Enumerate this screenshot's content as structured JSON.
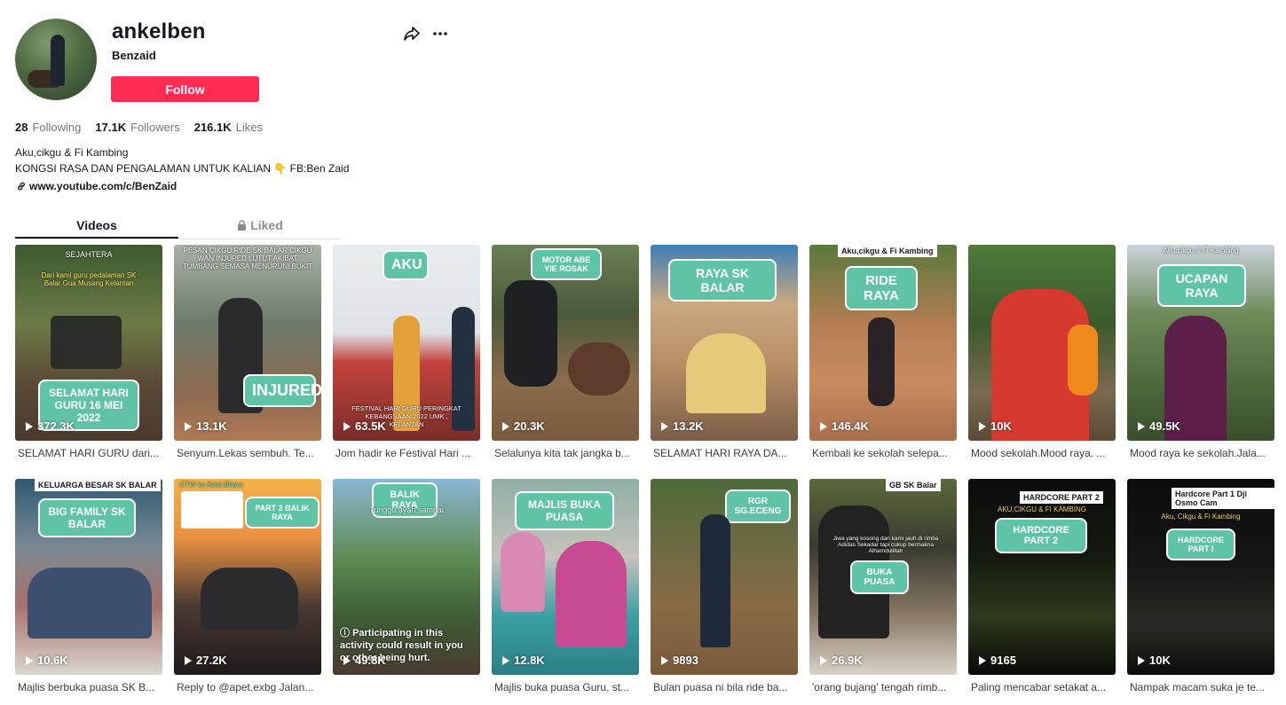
{
  "profile": {
    "username": "ankelben",
    "nickname": "Benzaid",
    "follow_label": "Follow",
    "stats": [
      {
        "value": "28",
        "label": "Following"
      },
      {
        "value": "17.1K",
        "label": "Followers"
      },
      {
        "value": "216.1K",
        "label": "Likes"
      }
    ],
    "bio_line1": "Aku,cikgu & Fi Kambing",
    "bio_line2": "KONGSI RASA DAN PENGALAMAN UNTUK KALIAN 👇 FB:Ben Zaid",
    "link": "www.youtube.com/c/BenZaid"
  },
  "tabs": {
    "videos": "Videos",
    "liked": "Liked"
  },
  "videos": [
    {
      "views": "372.3K",
      "caption": "SELAMAT HARI GURU dari...",
      "bubble": "SELAMAT HARI GURU 16 MEI 2022",
      "overlay": "SEJAHTERA",
      "sub": "Dari kami guru pedalaman SK Balar Gua Musang Kelantan"
    },
    {
      "views": "13.1K",
      "caption": "Senyum.Lekas sembuh. Te...",
      "bubble": "INJURED",
      "overlay": "PESAN CIKGU RIDE SK BALAR CIKGU WAN INJURED LUTUT AKIBAT TUMBANG SEMASA MENURUNI BUKIT"
    },
    {
      "views": "63.5K",
      "caption": "Jom hadir ke Festival Hari ...",
      "bubble": "AKU",
      "overlay": "FESTIVAL HARI GURU PERINGKAT KEBANGSAAN 2022 UMK , KELANTAN"
    },
    {
      "views": "20.3K",
      "caption": "Selalunya kita tak jangka b...",
      "bubble": "MOTOR ABE YIE ROSAK"
    },
    {
      "views": "13.2K",
      "caption": "SELAMAT HARI RAYA DA...",
      "bubble": "RAYA SK BALAR"
    },
    {
      "views": "146.4K",
      "caption": "Kembali ke sekolah selepa...",
      "bubble": "RIDE RAYA",
      "tag": "Aku,cikgu & Fi Kambing"
    },
    {
      "views": "10K",
      "caption": "Mood sekolah.Mood raya. ..."
    },
    {
      "views": "49.5K",
      "caption": "Mood raya ke sekolah.Jala...",
      "bubble": "UCAPAN RAYA",
      "overlay": "Aku,cikgu & Fi Kambing"
    },
    {
      "views": "10.6K",
      "caption": "Majlis berbuka puasa SK B...",
      "bubble": "BIG FAMILY SK BALAR",
      "tag": "KELUARGA BESAR SK BALAR"
    },
    {
      "views": "27.2K",
      "caption": "Reply to @apet.exbg Jalan...",
      "bubble": "PART 2 BALIK RAYA",
      "overlay": "OTW ke Kota Bharu"
    },
    {
      "views": "49.8K",
      "caption": "",
      "bubble": "BALIK RAYA",
      "overlay": "Tunggu ayah sampai",
      "notice": "Participating in this activity could result in you or other being hurt."
    },
    {
      "views": "12.8K",
      "caption": "Majlis buka puasa Guru, st...",
      "bubble": "MAJLIS BUKA PUASA"
    },
    {
      "views": "9893",
      "caption": "Bulan puasa ni bila ride ba...",
      "bubble": "RGR SG.ECENG"
    },
    {
      "views": "26.9K",
      "caption": "'orang bujang' tengah rimb...",
      "bubble": "BUKA PUASA",
      "tag": "GB SK Balar",
      "sub": "Jiwa yang kosong dari kami jauh di rimba Adidas Sekadar tapi cukup bermakna Alhamdulillah"
    },
    {
      "views": "9165",
      "caption": "Paling mencabar setakat a...",
      "bubble": "HARDCORE PART 2",
      "tag": "HARDCORE PART 2",
      "overlay": "AKU,CIKGU & FI KAMBING"
    },
    {
      "views": "10K",
      "caption": "Nampak macam suka je te...",
      "bubble": "HARDCORE PART I",
      "tag": "Hardcore Part 1 Dji Osmo Cam",
      "overlay": "Aku, Cikgu & Fi Kambing"
    }
  ]
}
